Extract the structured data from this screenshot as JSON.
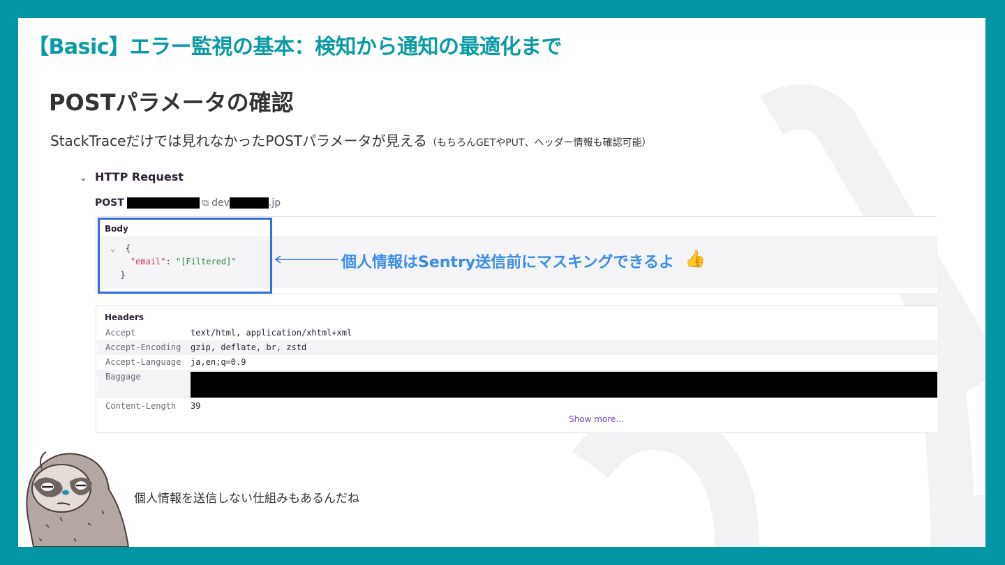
{
  "slide": {
    "main_title": "【Basic】エラー監視の基本：検知から通知の最適化まで",
    "section_title": "POSTパラメータの確認",
    "lead": "StackTraceだけでは見れなかったPOSTパラメータが見える",
    "lead_note": "（もちろんGETやPUT、ヘッダー情報も確認可能）",
    "caption": "個人情報を送信しない仕組みもあるんだね"
  },
  "http": {
    "section_label": "HTTP Request",
    "method": "POST",
    "host_prefix": "dev",
    "host_suffix": ".jp"
  },
  "body_panel": {
    "title": "Body",
    "open_brace": "{",
    "close_brace": "}",
    "key": "\"email\"",
    "colon": ": ",
    "value": "\"[Filtered]\""
  },
  "callout": {
    "text": "個人情報はSentry送信前にマスキングできるよ",
    "emoji": "👍"
  },
  "headers_panel": {
    "title": "Headers",
    "rows": [
      {
        "key": "Accept",
        "value": "text/html, application/xhtml+xml"
      },
      {
        "key": "Accept-Encoding",
        "value": "gzip, deflate, br, zstd"
      },
      {
        "key": "Accept-Language",
        "value": "ja,en;q=0.9"
      },
      {
        "key": "Baggage",
        "value": ""
      },
      {
        "key": "Content-Length",
        "value": "39"
      }
    ],
    "show_more": "Show more..."
  },
  "colors": {
    "frame": "#0296a4",
    "title": "#0a9aa6",
    "highlight": "#2f6fe0",
    "callout": "#3b8ee8",
    "json_key": "#d23c55",
    "json_string": "#2e8a44",
    "link": "#6f4ab8"
  }
}
